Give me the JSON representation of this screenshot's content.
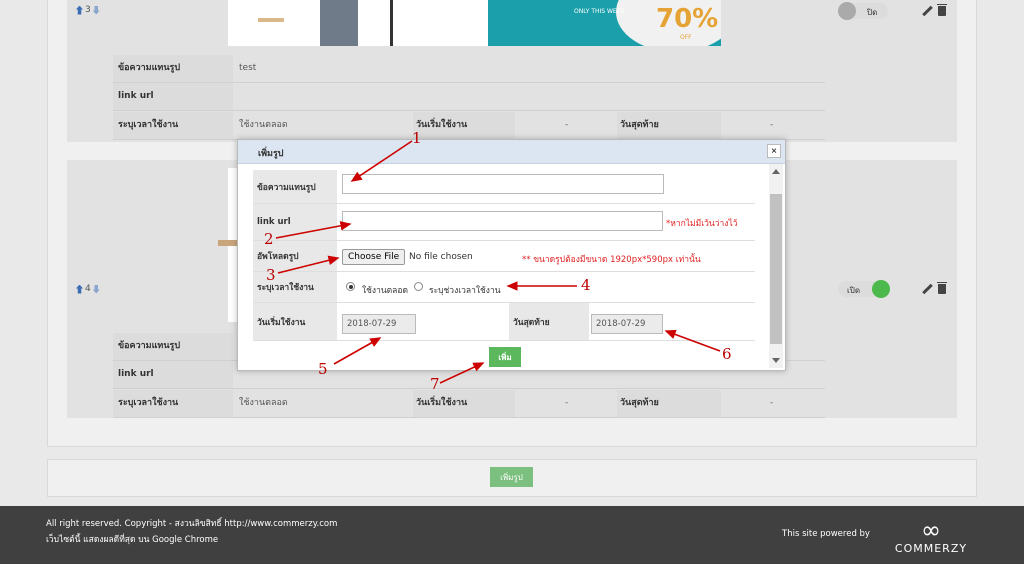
{
  "rows": [
    {
      "order": "3",
      "caption_label": "ข้อความแทนรูป",
      "caption_value": "test",
      "link_label": "link url",
      "period_label": "ระบุเวลาใช้งาน",
      "period_value": "ใช้งานตลอด",
      "start_label": "วันเริ่มใช้งาน",
      "start_value": "-",
      "end_label": "วันสุดท้าย",
      "end_value": "-",
      "toggle": {
        "label": "ปิด",
        "on": false
      },
      "banner": {
        "tag": "ONLY THIS WEEK",
        "percent": "70%",
        "off": "OFF"
      }
    },
    {
      "order": "4",
      "caption_label": "ข้อความแทนรูป",
      "caption_value": "",
      "link_label": "link url",
      "period_label": "ระบุเวลาใช้งาน",
      "period_value": "ใช้งานตลอด",
      "start_label": "วันเริ่มใช้งาน",
      "start_value": "-",
      "end_label": "วันสุดท้าย",
      "end_value": "-",
      "toggle": {
        "label": "เปิด",
        "on": true
      }
    }
  ],
  "add_button_label": "เพิ่มรูป",
  "modal": {
    "title": "เพิ่มรูป",
    "close_glyph": "×",
    "caption_label": "ข้อความแทนรูป",
    "caption_value": "",
    "link_label": "link url",
    "link_value": "",
    "link_hint": "*หากไม่มีเว้นว่างไว้",
    "upload_label": "อัพโหลดรูป",
    "file_button": "Choose File",
    "file_status": "No file chosen",
    "upload_hint": "** ขนาดรูปต้องมีขนาด 1920px*590px เท่านั้น",
    "period_label": "ระบุเวลาใช้งาน",
    "option_always": "ใช้งานตลอด",
    "option_range": "ระบุช่วงเวลาใช้งาน",
    "start_label": "วันเริ่มใช้งาน",
    "start_value": "2018-07-29",
    "end_label": "วันสุดท้าย",
    "end_value": "2018-07-29",
    "submit_label": "เพิ่ม"
  },
  "annotations": [
    "1",
    "2",
    "3",
    "4",
    "5",
    "6",
    "7"
  ],
  "annotation_color": "#cc0000",
  "footer": {
    "copyright": "All right reserved. Copyright - สงวนลิขสิทธิ์ http://www.commerzy.com",
    "browser_note": "เว็บไซต์นี้ แสดงผลดีที่สุด บน Google Chrome",
    "powered_by": "This site powered by",
    "logo_glyph": "∞",
    "brand": "COMMERZY"
  },
  "colors": {
    "green": "#5cb85c",
    "header_blue": "#dce6f2",
    "footer_bg": "#404040"
  }
}
